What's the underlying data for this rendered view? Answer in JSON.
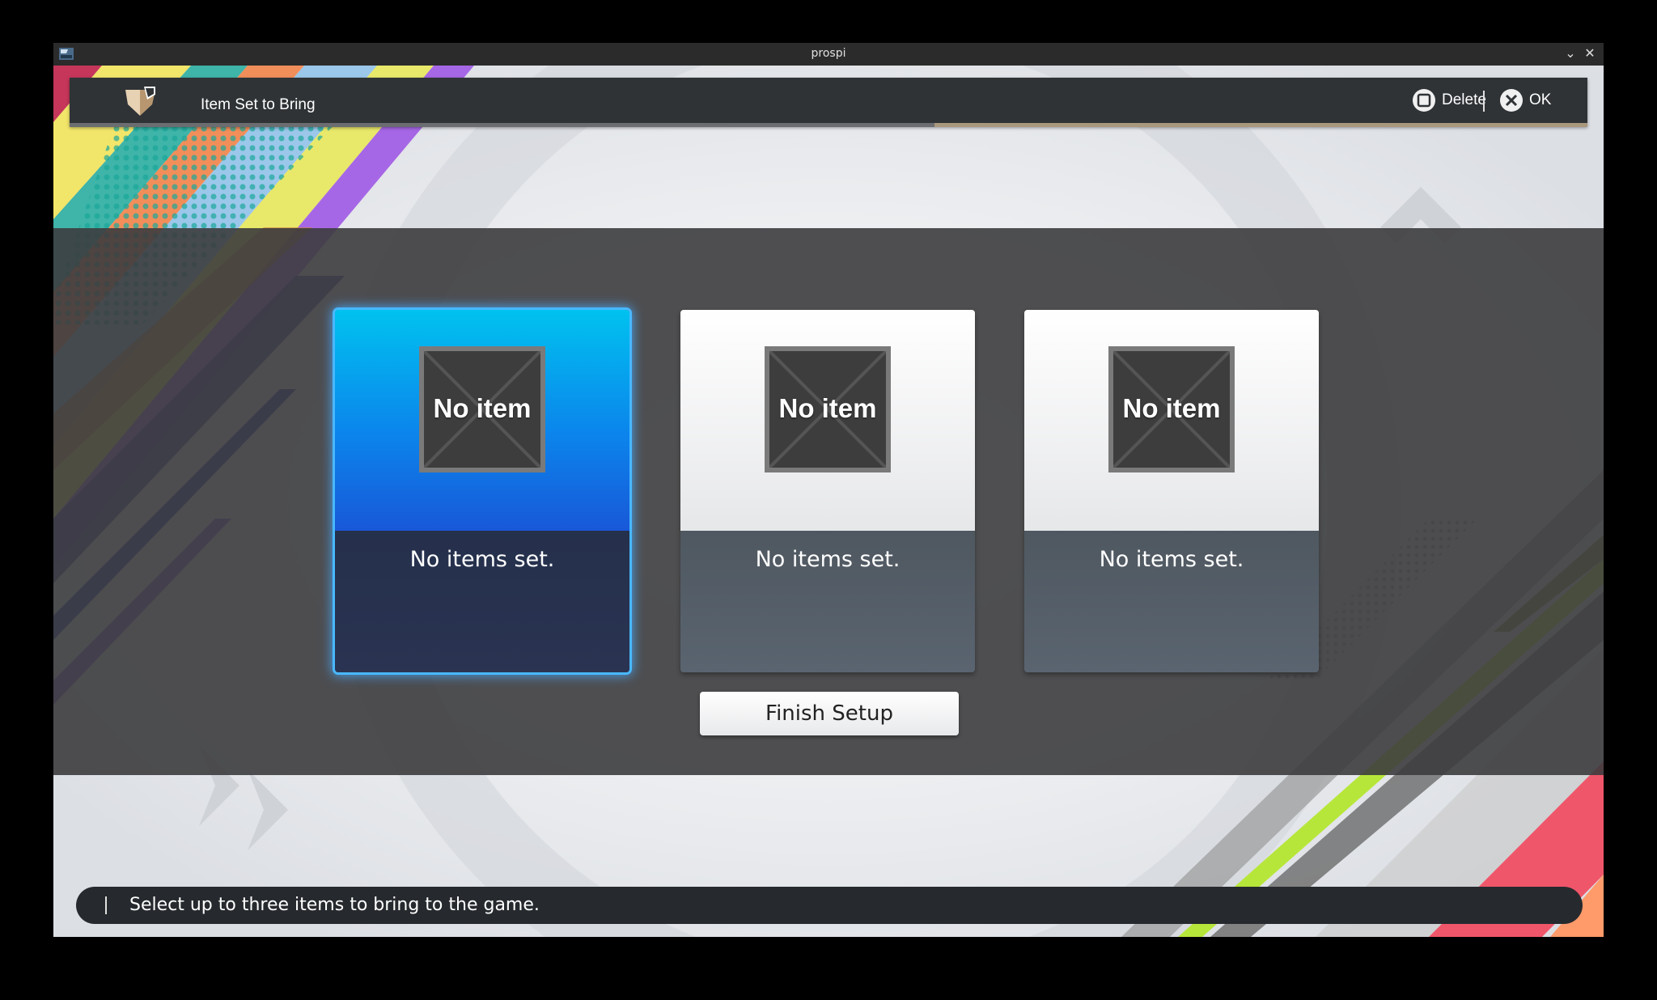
{
  "window": {
    "title": "prospi",
    "minimize_glyph": "⌄",
    "close_glyph": "✕"
  },
  "header": {
    "menu_title": "Item Set to Bring",
    "menu_icon": "shield-icon",
    "delete_label": "Delete",
    "delete_glyph": "square-button-icon",
    "ok_label": "OK",
    "ok_glyph": "cross-button-icon",
    "progress": 0.57
  },
  "item_sets": [
    {
      "slot_label": "No item",
      "description": "No items set.",
      "selected": true
    },
    {
      "slot_label": "No item",
      "description": "No items set.",
      "selected": false
    },
    {
      "slot_label": "No item",
      "description": "No items set.",
      "selected": false
    }
  ],
  "finish_button": {
    "label": "Finish Setup"
  },
  "help": {
    "text": "Select up to three items to bring to the game."
  },
  "colors": {
    "selected_top": "#0b86ec",
    "selected_glow": "#49b8ff",
    "header_bg": "#2f3336",
    "progress_fill": "#a8987c"
  }
}
